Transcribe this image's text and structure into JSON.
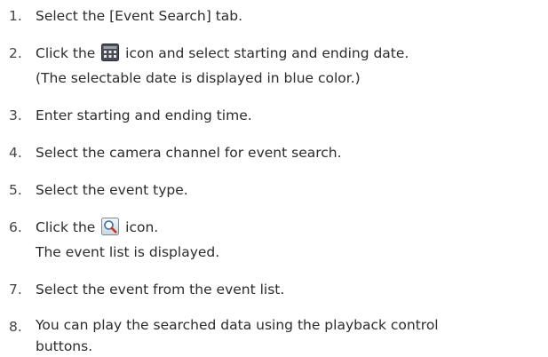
{
  "steps": [
    {
      "number": "1.",
      "text": "Select the [Event Search] tab."
    },
    {
      "number": "2.",
      "before_icon": "Click the",
      "icon": "calendar-icon",
      "after_icon": "icon and select starting and ending date.",
      "line2": "(The selectable date is displayed in blue color.)"
    },
    {
      "number": "3.",
      "text": "Enter starting and ending time."
    },
    {
      "number": "4.",
      "text": "Select the camera channel for event search."
    },
    {
      "number": "5.",
      "text": "Select the event type."
    },
    {
      "number": "6.",
      "before_icon": "Click the",
      "icon": "search-magnifier-icon",
      "after_icon": "icon.",
      "line2": "The event list is displayed."
    },
    {
      "number": "7.",
      "text": "Select the event from the event list."
    },
    {
      "number": "8.",
      "text": "You can play the searched data using the playback control",
      "line2": "buttons."
    }
  ]
}
